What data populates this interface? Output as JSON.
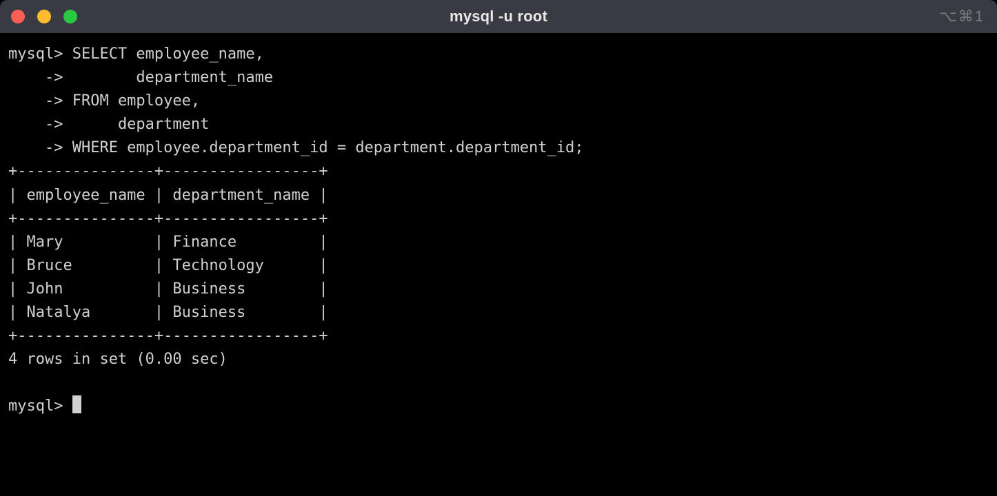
{
  "window": {
    "title": "mysql -u root",
    "shortcut_hint": "⌥⌘1"
  },
  "session": {
    "prompt": "mysql>",
    "continuation_prompt": "    ->",
    "query_lines": [
      "mysql> SELECT employee_name,",
      "    ->        department_name",
      "    -> FROM employee,",
      "    ->      department",
      "    -> WHERE employee.department_id = department.department_id;"
    ],
    "table": {
      "border_top": "+---------------+-----------------+",
      "header_line": "| employee_name | department_name |",
      "border_mid": "+---------------+-----------------+",
      "rows": [
        "| Mary          | Finance         |",
        "| Bruce         | Technology      |",
        "| John          | Business        |",
        "| Natalya       | Business        |"
      ],
      "border_bottom": "+---------------+-----------------+",
      "columns": [
        "employee_name",
        "department_name"
      ],
      "data": [
        {
          "employee_name": "Mary",
          "department_name": "Finance"
        },
        {
          "employee_name": "Bruce",
          "department_name": "Technology"
        },
        {
          "employee_name": "John",
          "department_name": "Business"
        },
        {
          "employee_name": "Natalya",
          "department_name": "Business"
        }
      ]
    },
    "summary": "4 rows in set (0.00 sec)",
    "next_prompt": "mysql> "
  }
}
